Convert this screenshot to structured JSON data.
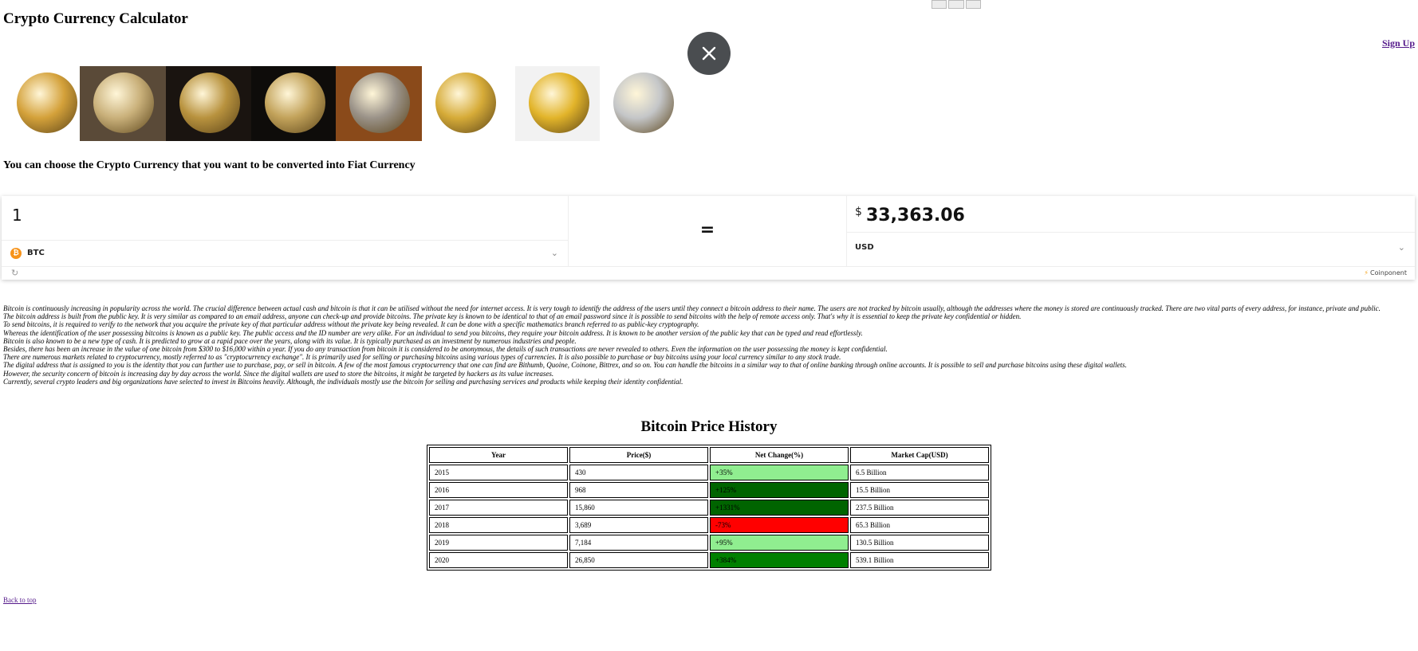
{
  "page": {
    "title": "Crypto Currency Calculator",
    "signup": "Sign Up",
    "lead": "You can choose the Crypto Currency that you want to be converted into Fiat Currency",
    "back_to_top": "Back to top"
  },
  "coins": [
    {
      "icon": "bitcoin-coin-image",
      "bg": "#ffffff",
      "disc": "#d4a13a"
    },
    {
      "icon": "ethereum-coin-image",
      "bg": "#5a4a38",
      "disc": "#c9b07a"
    },
    {
      "icon": "binance-coin-image",
      "bg": "#1a1410",
      "disc": "#b8923e"
    },
    {
      "icon": "xrp-coin-image",
      "bg": "#0e0c0a",
      "disc": "#c2a25a"
    },
    {
      "icon": "tether-coin-image",
      "bg": "#8a4a1a",
      "disc": "#9a9288"
    },
    {
      "icon": "cardano-coin-image",
      "bg": "#ffffff",
      "disc": "#d6ab38"
    },
    {
      "icon": "dogecoin-coin-image",
      "bg": "#f2f2f2",
      "disc": "#e2b42a"
    },
    {
      "icon": "litecoin-coin-image",
      "bg": "#ffffff",
      "disc": "#c4c6c8"
    }
  ],
  "widget": {
    "amount": "1",
    "from_currency": "BTC",
    "equals": "=",
    "currency_sign": "$",
    "result": "33,363.06",
    "to_currency": "USD",
    "powered_by": "Coinponent"
  },
  "article": [
    "Bitcoin is continuously increasing in popularity across the world. The crucial difference between actual cash and bitcoin is that it can be utilised without the need for internet access. It is very tough to identify the address of the users until they connect a bitcoin address to their name. The users are not tracked by bitcoin usually, although the addresses where the money is stored are continuously tracked. There are two vital parts of every address, for instance, private and public.",
    "The bitcoin address is built from the public key. It is very similar as compared to an email address, anyone can check-up and provide bitcoins. The private key is known to be identical to that of an email password since it is possible to send bitcoins with the help of remote access only. That's why it is essential to keep the private key confidential or hidden.",
    "To send bitcoins, it is required to verify to the network that you acquire the private key of that particular address without the private key being revealed. It can be done with a specific mathematics branch referred to as public-key cryptography.",
    "Whereas the identification of the user possessing bitcoins is known as a public key. The public access and the ID number are very alike. For an individual to send you bitcoins, they require your bitcoin address. It is known to be another version of the public key that can be typed and read effortlessly.",
    "Bitcoin is also known to be a new type of cash. It is predicted to grow at a rapid pace over the years, along with its value. It is typically purchased as an investment by numerous industries and people.",
    "Besides, there has been an increase in the value of one bitcoin from $300 to $16,000 within a year. If you do any transaction from bitcoin it is considered to be anonymous, the details of such transactions are never revealed to others. Even the information on the user possessing the money is kept confidential.",
    "There are numerous markets related to cryptocurrency, mostly referred to as \"cryptocurrency exchange\". It is primarily used for selling or purchasing bitcoins using various types of currencies. It is also possible to purchase or buy bitcoins using your local currency similar to any stock trade.",
    "The digital address that is assigned to you is the identity that you can further use to purchase, pay, or sell in bitcoin. A few of the most famous cryptocurrency that one can find are Bithumb, Quoine, Coinone, Bittrex, and so on. You can handle the bitcoins in a similar way to that of online banking through online accounts. It is possible to sell and purchase bitcoins using these digital wallets.",
    "However, the security concern of bitcoin is increasing day by day across the world. Since the digital wallets are used to store the bitcoins, it might be targeted by hackers as its value increases.",
    "Currently, several crypto leaders and big organizations have selected to invest in Bitcoins heavily. Although, the individuals mostly use the bitcoin for selling and purchasing services and products while keeping their identity confidential."
  ],
  "history": {
    "title": "Bitcoin Price History",
    "headers": [
      "Year",
      "Price($)",
      "Net Change(%)",
      "Market Cap(USD)"
    ],
    "rows": [
      {
        "year": "2015",
        "price": "430",
        "change": "+35%",
        "cap": "6.5 Billion",
        "color": "#90ee90"
      },
      {
        "year": "2016",
        "price": "968",
        "change": "+125%",
        "cap": "15.5 Billion",
        "color": "#006400"
      },
      {
        "year": "2017",
        "price": "15,860",
        "change": "+1331%",
        "cap": "237.5 Billion",
        "color": "#006400"
      },
      {
        "year": "2018",
        "price": "3,689",
        "change": "-73%",
        "cap": "65.3 Billion",
        "color": "#ff0000"
      },
      {
        "year": "2019",
        "price": "7,184",
        "change": "+95%",
        "cap": "130.5 Billion",
        "color": "#90ee90"
      },
      {
        "year": "2020",
        "price": "26,850",
        "change": "+384%",
        "cap": "539.1 Billion",
        "color": "#008000"
      }
    ]
  }
}
